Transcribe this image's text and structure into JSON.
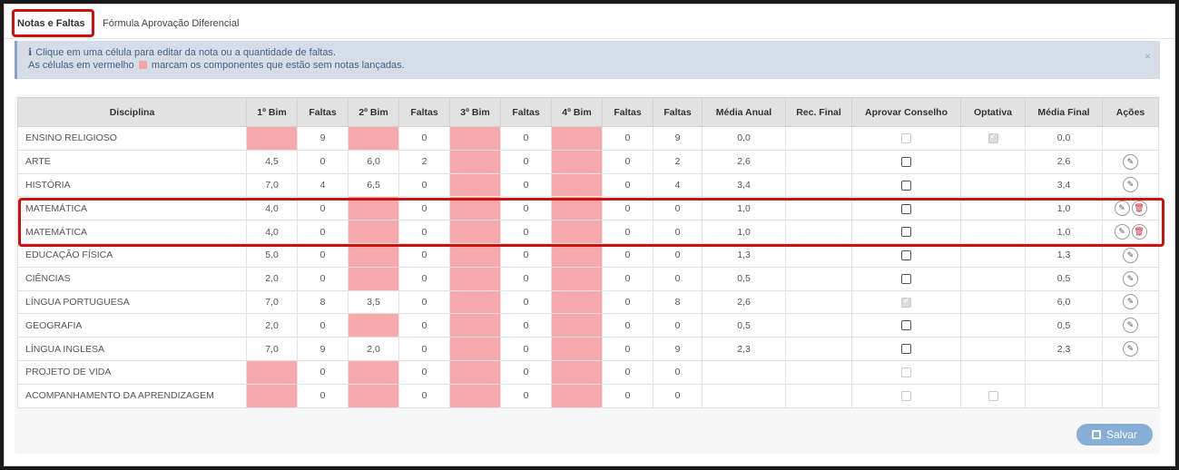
{
  "tabs": [
    {
      "label": "Notas e Faltas",
      "active": true
    },
    {
      "label": "Fórmula Aprovação Diferencial",
      "active": false
    }
  ],
  "alert": {
    "line1": "Clique em uma célula para editar da nota ou a quantidade de faltas.",
    "line2_prefix": "As células em vermelho",
    "line2_suffix": "marcam os componentes que estão sem notas lançadas.",
    "close": "×"
  },
  "columns": [
    "Disciplina",
    "1º Bim",
    "Faltas",
    "2º Bim",
    "Faltas",
    "3º Bim",
    "Faltas",
    "4º Bim",
    "Faltas",
    "Faltas",
    "Média Anual",
    "Rec. Final",
    "Aprovar Conselho",
    "Optativa",
    "Média Final",
    "Ações"
  ],
  "rows": [
    {
      "disciplina": "ENSINO RELIGIOSO",
      "b1": "",
      "b1_color": "",
      "f1": "9",
      "b2": "",
      "b2_color": "",
      "f2": "0",
      "b3": "",
      "f3": "0",
      "b4": "",
      "f4": "0",
      "faltas": "9",
      "media_anual": "0,0",
      "rec_final": "",
      "aprovar": "disabled",
      "optativa": "checked",
      "media_final": "0,0",
      "mf_color": "red",
      "acoes": []
    },
    {
      "disciplina": "ARTE",
      "b1": "4,5",
      "b1_color": "red",
      "f1": "0",
      "b2": "6,0",
      "b2_color": "blue",
      "f2": "2",
      "b3": "",
      "f3": "0",
      "b4": "",
      "f4": "0",
      "faltas": "2",
      "media_anual": "2,6",
      "rec_final": "",
      "aprovar": "enabled",
      "optativa": "none",
      "media_final": "2,6",
      "mf_color": "red",
      "acoes": [
        "edit"
      ]
    },
    {
      "disciplina": "HISTÓRIA",
      "b1": "7,0",
      "b1_color": "blue",
      "f1": "4",
      "b2": "6,5",
      "b2_color": "blue",
      "f2": "0",
      "b3": "",
      "f3": "0",
      "b4": "",
      "f4": "0",
      "faltas": "4",
      "media_anual": "3,4",
      "rec_final": "",
      "aprovar": "enabled",
      "optativa": "none",
      "media_final": "3,4",
      "mf_color": "red",
      "acoes": [
        "edit"
      ]
    },
    {
      "disciplina": "MATEMÁTICA",
      "b1": "4,0",
      "b1_color": "red",
      "f1": "0",
      "b2": "",
      "b2_color": "",
      "f2": "0",
      "b3": "",
      "f3": "0",
      "b4": "",
      "f4": "0",
      "faltas": "0",
      "media_anual": "1,0",
      "rec_final": "",
      "aprovar": "enabled",
      "optativa": "none",
      "media_final": "1,0",
      "mf_color": "red",
      "acoes": [
        "edit",
        "delete"
      ]
    },
    {
      "disciplina": "MATEMÁTICA",
      "b1": "4,0",
      "b1_color": "red",
      "f1": "0",
      "b2": "",
      "b2_color": "",
      "f2": "0",
      "b3": "",
      "f3": "0",
      "b4": "",
      "f4": "0",
      "faltas": "0",
      "media_anual": "1,0",
      "rec_final": "",
      "aprovar": "enabled",
      "optativa": "none",
      "media_final": "1,0",
      "mf_color": "red",
      "acoes": [
        "edit",
        "delete"
      ]
    },
    {
      "disciplina": "EDUCAÇÃO FÍSICA",
      "b1": "5,0",
      "b1_color": "red",
      "f1": "0",
      "b2": "",
      "b2_color": "",
      "f2": "0",
      "b3": "",
      "f3": "0",
      "b4": "",
      "f4": "0",
      "faltas": "0",
      "media_anual": "1,3",
      "rec_final": "",
      "aprovar": "enabled",
      "optativa": "none",
      "media_final": "1,3",
      "mf_color": "red",
      "acoes": [
        "edit"
      ]
    },
    {
      "disciplina": "CIÊNCIAS",
      "b1": "2,0",
      "b1_color": "red",
      "f1": "0",
      "b2": "",
      "b2_color": "",
      "f2": "0",
      "b3": "",
      "f3": "0",
      "b4": "",
      "f4": "0",
      "faltas": "0",
      "media_anual": "0,5",
      "rec_final": "",
      "aprovar": "enabled",
      "optativa": "none",
      "media_final": "0,5",
      "mf_color": "red",
      "acoes": [
        "edit"
      ]
    },
    {
      "disciplina": "LÍNGUA PORTUGUESA",
      "b1": "7,0",
      "b1_color": "blue",
      "f1": "8",
      "b2": "3,5",
      "b2_color": "red",
      "f2": "0",
      "b3": "",
      "f3": "0",
      "b4": "",
      "f4": "0",
      "faltas": "8",
      "media_anual": "2,6",
      "rec_final": "",
      "aprovar": "checked",
      "optativa": "none",
      "media_final": "6,0",
      "mf_color": "blue",
      "acoes": [
        "edit"
      ]
    },
    {
      "disciplina": "GEOGRAFIA",
      "b1": "2,0",
      "b1_color": "red",
      "f1": "0",
      "b2": "",
      "b2_color": "",
      "f2": "0",
      "b3": "",
      "f3": "0",
      "b4": "",
      "f4": "0",
      "faltas": "0",
      "media_anual": "0,5",
      "rec_final": "",
      "aprovar": "enabled",
      "optativa": "none",
      "media_final": "0,5",
      "mf_color": "red",
      "acoes": [
        "edit"
      ]
    },
    {
      "disciplina": "LÍNGUA INGLESA",
      "b1": "7,0",
      "b1_color": "blue",
      "f1": "9",
      "b2": "2,0",
      "b2_color": "red",
      "f2": "0",
      "b3": "",
      "f3": "0",
      "b4": "",
      "f4": "0",
      "faltas": "9",
      "media_anual": "2,3",
      "rec_final": "",
      "aprovar": "enabled",
      "optativa": "none",
      "media_final": "2,3",
      "mf_color": "red",
      "acoes": [
        "edit"
      ]
    },
    {
      "disciplina": "PROJETO DE VIDA",
      "b1": "",
      "b1_color": "",
      "f1": "0",
      "b2": "",
      "b2_color": "",
      "f2": "0",
      "b3": "",
      "f3": "0",
      "b4": "",
      "f4": "0",
      "faltas": "0",
      "media_anual": "",
      "rec_final": "",
      "aprovar": "disabled",
      "optativa": "none",
      "media_final": "",
      "mf_color": "",
      "acoes": []
    },
    {
      "disciplina": "ACOMPANHAMENTO DA APRENDIZAGEM",
      "b1": "",
      "b1_color": "",
      "f1": "0",
      "b2": "",
      "b2_color": "",
      "f2": "0",
      "b3": "",
      "f3": "0",
      "b4": "",
      "f4": "0",
      "faltas": "0",
      "media_anual": "",
      "rec_final": "",
      "aprovar": "disabled",
      "optativa": "disabled",
      "media_final": "",
      "mf_color": "",
      "acoes": []
    }
  ],
  "save_button": {
    "label": "Salvar",
    "icon": "floppy-disk-icon"
  },
  "colors": {
    "missing_cell": "#f8a9ac",
    "grade_low": "#b01c38",
    "grade_ok": "#4b86b4",
    "highlight_box": "#cc1111",
    "alert_bg": "#d5dde8"
  }
}
